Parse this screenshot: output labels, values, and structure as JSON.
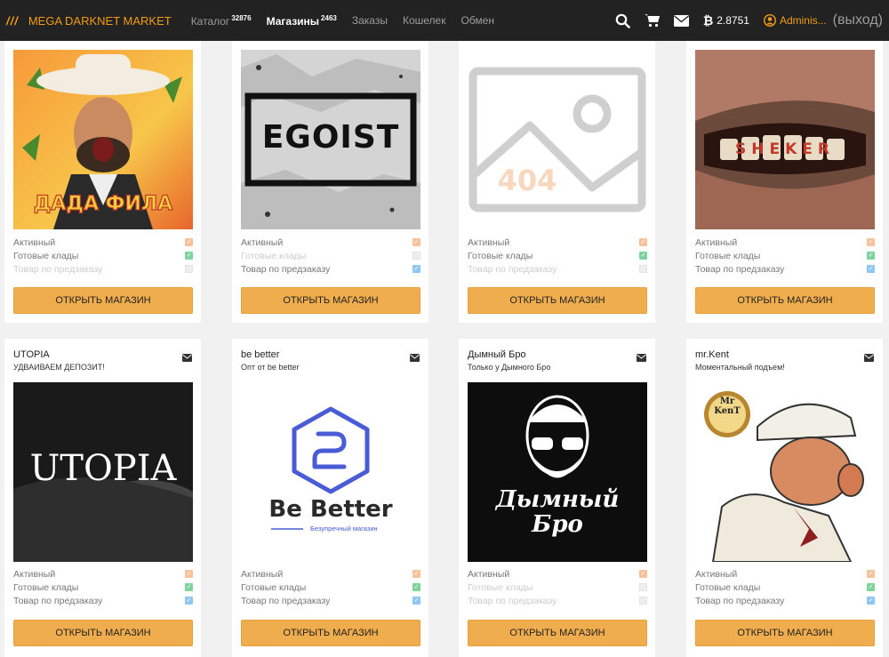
{
  "nav": {
    "brand_mark": "///",
    "brand": "MEGA DARKNET MARKET",
    "links": [
      {
        "label": "Каталог",
        "count": "32876"
      },
      {
        "label": "Магазины",
        "count": "2463"
      },
      {
        "label": "Заказы",
        "count": ""
      },
      {
        "label": "Кошелек",
        "count": ""
      },
      {
        "label": "Обмен",
        "count": ""
      }
    ],
    "btc_balance": "2.8751",
    "user": "Adminis...",
    "logout": "(выход)"
  },
  "flag_labels": {
    "active": "Активный",
    "ready": "Готовые клады",
    "preorder": "Товар по предзаказу"
  },
  "open_label": "ОТКРЫТЬ МАГАЗИН",
  "colors": {
    "accent": "#f0ad4e",
    "navbar": "#222222"
  },
  "shops": [
    {
      "name": "",
      "subtitle": "",
      "image_text": "ДАДА ФИЛА",
      "flags": {
        "active": true,
        "ready": true,
        "preorder": false
      }
    },
    {
      "name": "",
      "subtitle": "",
      "image_text": "EGOIST",
      "flags": {
        "active": true,
        "ready": false,
        "preorder": true
      }
    },
    {
      "name": "",
      "subtitle": "",
      "image_text": "404",
      "flags": {
        "active": true,
        "ready": true,
        "preorder": false
      }
    },
    {
      "name": "",
      "subtitle": "",
      "image_text": "SHEKER",
      "flags": {
        "active": true,
        "ready": true,
        "preorder": true
      }
    },
    {
      "name": "UTOPIA",
      "subtitle": "УДВАИВАЕМ ДЕПОЗИТ!",
      "image_text": "UTOPIA",
      "flags": {
        "active": true,
        "ready": true,
        "preorder": true
      }
    },
    {
      "name": "be better",
      "subtitle": "Опт от be better",
      "image_text": "Be Better",
      "image_sub": "Безупречный магазин",
      "flags": {
        "active": true,
        "ready": true,
        "preorder": true
      }
    },
    {
      "name": "Дымный Бро",
      "subtitle": "Только у Дымного Бро",
      "image_text": "Дымный Бро",
      "flags": {
        "active": true,
        "ready": false,
        "preorder": false
      }
    },
    {
      "name": "mr.Kent",
      "subtitle": "Моментальный подъем!",
      "image_text": "Mr KenT",
      "flags": {
        "active": true,
        "ready": true,
        "preorder": true
      }
    }
  ]
}
